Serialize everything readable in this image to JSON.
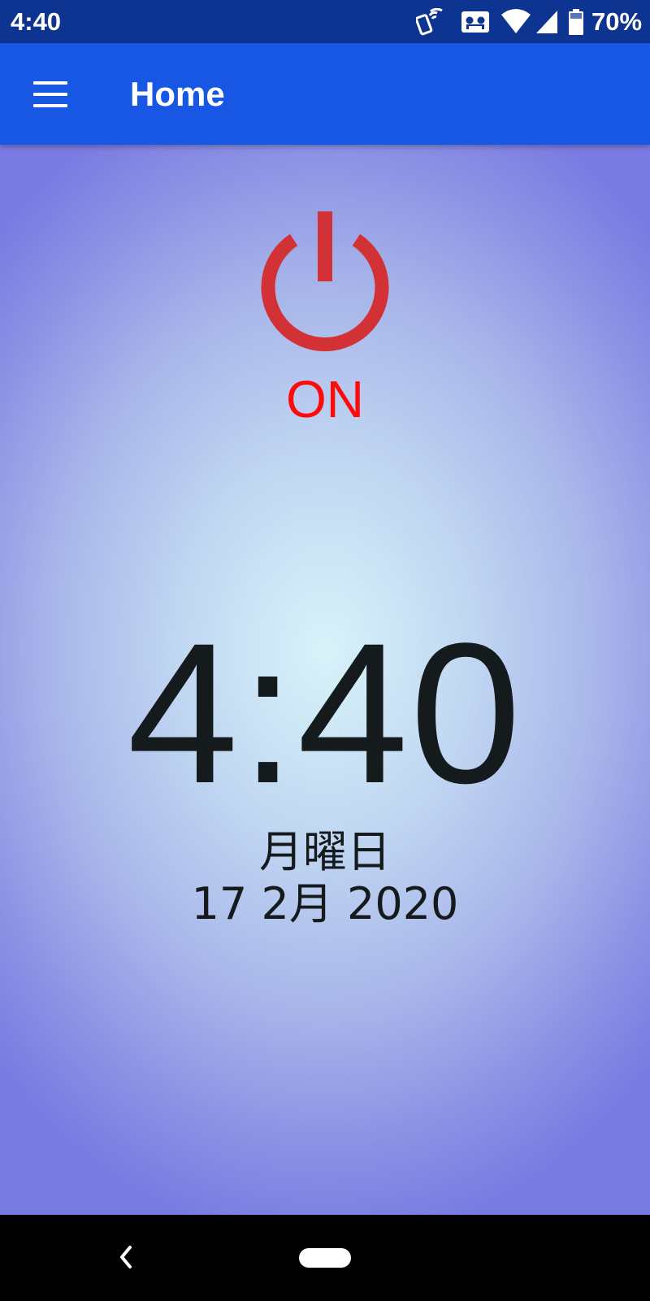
{
  "status_bar": {
    "time": "4:40",
    "battery": "70%",
    "icons": [
      "nfc-phone-icon",
      "voicemail-icon",
      "wifi-icon",
      "cell-signal-icon",
      "battery-icon"
    ]
  },
  "app_bar": {
    "title": "Home",
    "menu_icon": "hamburger-menu-icon",
    "color": "#1757e3"
  },
  "power": {
    "icon": "power-icon",
    "status": "ON",
    "icon_color": "#d23236",
    "status_color": "#ff0a0a"
  },
  "clock": {
    "time": "4:40",
    "day": "月曜日",
    "date": "17 2月 2020"
  },
  "nav_bar": {
    "icons": [
      "back-icon",
      "home-pill-icon"
    ]
  }
}
